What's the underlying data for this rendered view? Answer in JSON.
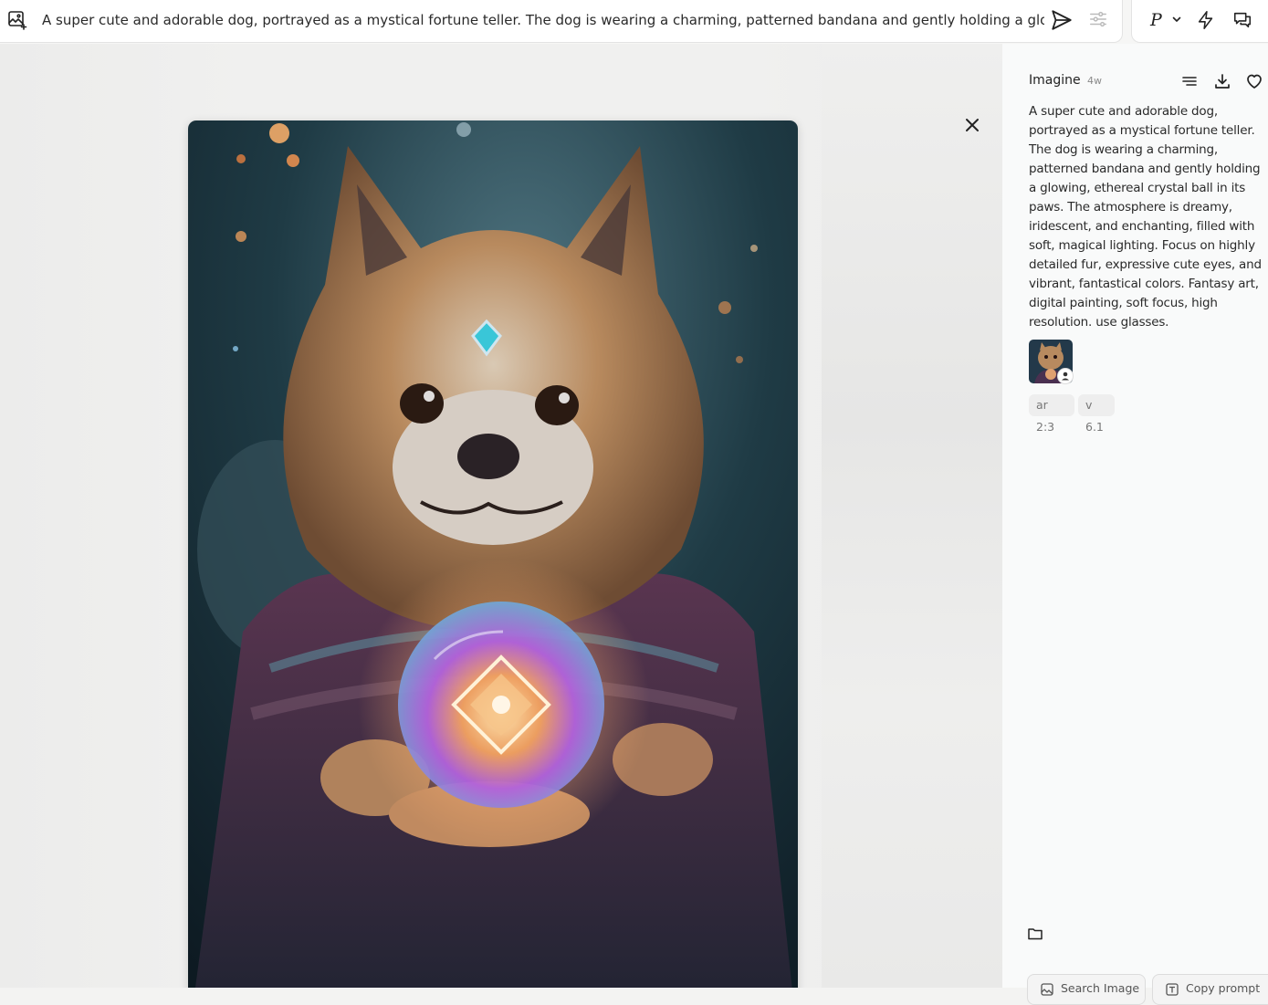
{
  "prompt_bar": {
    "text": "A super cute and adorable dog, portrayed as a mystical fortune teller. The dog is wearing a charming, patterned bandana and gently holding a glowing, ethereal crystal ball in its paws."
  },
  "mode": {
    "label": "P"
  },
  "panel": {
    "title": "Imagine",
    "age": "4w",
    "prompt": "A super cute and adorable dog, portrayed as a mystical fortune teller. The dog is wearing a charming, patterned bandana and gently holding a glowing, ethereal crystal ball in its paws. The atmosphere is dreamy, iridescent, and enchanting, filled with soft, magical lighting. Focus on highly detailed fur, expressive cute eyes, and vibrant, fantastical colors. Fantasy art, digital painting, soft focus, high resolution. use glasses.",
    "params": [
      "ar 2:3",
      "v 6.1"
    ],
    "buttons": {
      "search_image": "Search Image",
      "copy_prompt": "Copy prompt"
    }
  },
  "icons": {
    "add_image": "image-plus-icon",
    "send": "send-icon",
    "settings": "sliders-icon",
    "chevron": "chevron-down-icon",
    "bolt": "lightning-icon",
    "chat": "chat-icon",
    "close": "close-icon",
    "list": "list-icon",
    "download": "download-icon",
    "heart": "heart-icon",
    "folder": "folder-icon"
  },
  "colors": {
    "accent_text": "#222222",
    "muted_text": "#8a8a8a",
    "chip_bg": "#eeeeee"
  }
}
